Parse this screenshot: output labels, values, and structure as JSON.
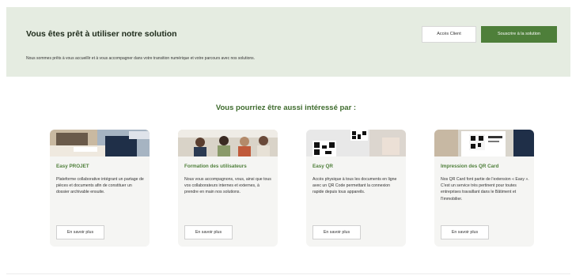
{
  "banner": {
    "title": "Vous êtes prêt à utiliser notre solution",
    "text": "Nous sommes prêts à vous accueillir et à vous accompagner dans votre transition numérique et votre parcours avec nos solutions.",
    "client_button": "Accès Client",
    "subscribe_button": "Souscrire à la solution"
  },
  "section": {
    "title": "Vous pourriez être aussi intéressé par :"
  },
  "cards": [
    {
      "title": "Easy PROJET",
      "desc": "Plateforme collaborative intégrant un partage de pièces et documents afin de constituer un dossier archivable ensuite.",
      "button": "En savoir plus"
    },
    {
      "title": "Formation des utilisateurs",
      "desc": "Nous vous accompagnons, vous, ainsi que tous vos collaborateurs internes et externes, à prendre en main nos solutions.",
      "button": "En savoir plus"
    },
    {
      "title": "Easy QR",
      "desc": "Accès physique à tous les documents en ligne avec un QR Code permettant la connexion rapide depuis tous appareils.",
      "button": "En savoir plus"
    },
    {
      "title": "Impression des QR Card",
      "desc": "Nos QR Card font partie de l'extension « Easy ». C'est un service très pertinent pour toutes entreprises travaillant dans le Bâtiment et l'Immobilier.",
      "button": "En savoir plus"
    }
  ],
  "colors": {
    "accent": "#4e7f3a",
    "banner_bg": "#e5ece1",
    "card_bg": "#f5f5f3"
  }
}
